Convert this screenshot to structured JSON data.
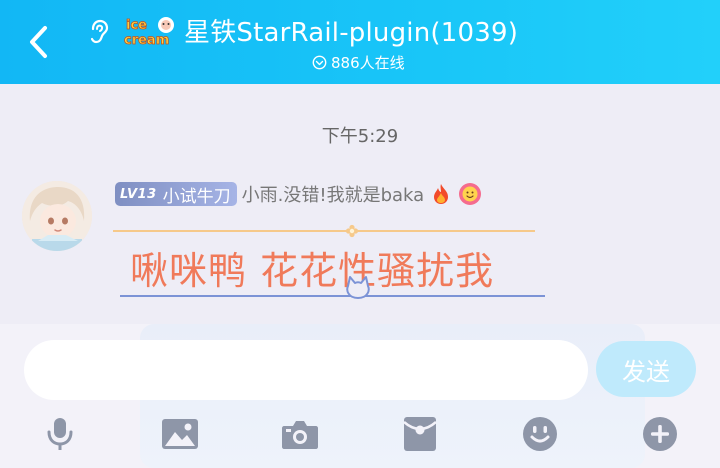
{
  "header": {
    "title": "星铁StarRail-plugin(1039)",
    "online_text": "886人在线",
    "logo_text": "IceCream"
  },
  "chat": {
    "timestamp": "下午5:29",
    "message": {
      "level": "LV13",
      "level_title": "小试牛刀",
      "sender": "小雨.没错!我就是baka",
      "text": "啾咪鸭 花花性骚扰我"
    }
  },
  "input": {
    "value": "",
    "placeholder": "",
    "send_label": "发送"
  },
  "toolbar": {
    "icons": [
      "microphone-icon",
      "image-icon",
      "camera-icon",
      "red-packet-icon",
      "emoji-icon",
      "plus-icon"
    ]
  },
  "colors": {
    "header": "#12b7f5",
    "message_text": "#f07a5a",
    "send_button": "#bfeafc",
    "toolbar_icon": "#8e96a8"
  }
}
